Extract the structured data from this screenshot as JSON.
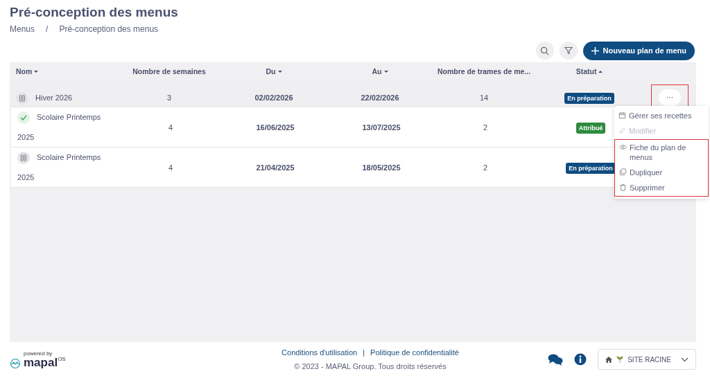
{
  "page": {
    "title": "Pré-conception des menus",
    "breadcrumb": [
      {
        "label": "Menus"
      },
      {
        "label": "Pré-conception des menus"
      }
    ],
    "breadcrumb_separator": "/"
  },
  "toolbar": {
    "new_button": "Nouveau plan de menu"
  },
  "table": {
    "columns": [
      {
        "label": "Nom",
        "kind": "desc"
      },
      {
        "label": "Nombre de semaines",
        "kind": "plain"
      },
      {
        "label": "Du",
        "kind": "desc"
      },
      {
        "label": "Au",
        "kind": "desc"
      },
      {
        "label": "Nombre de trames de me...",
        "kind": "plain"
      },
      {
        "label": "Statut",
        "kind": "asc"
      }
    ],
    "rows": [
      {
        "name": "Hiver 2026",
        "kind": "paused",
        "weeks": "3",
        "from": "02/02/2026",
        "to": "22/02/2026",
        "frames": "14",
        "status": "En préparation",
        "color": "#0f4c81",
        "selected": true,
        "actions": "···",
        "actions_highlighted": true
      },
      {
        "name": "Scolaire Printemps 2025",
        "kind": "assigned",
        "weeks": "4",
        "from": "16/06/2025",
        "to": "13/07/2025",
        "frames": "2",
        "status": "Attribué",
        "color": "#2e8b3e",
        "selected": false
      },
      {
        "name": "Scolaire Printemps 2025",
        "kind": "paused",
        "weeks": "4",
        "from": "21/04/2025",
        "to": "18/05/2025",
        "frames": "2",
        "status": "En préparation",
        "color": "#0f4c81",
        "selected": false
      }
    ]
  },
  "menu": {
    "items": [
      {
        "label": "Gérer ses recettes",
        "kind": "calendar",
        "disabled": false,
        "highlighted": false
      },
      {
        "label": "Modifier",
        "kind": "pencil",
        "disabled": true,
        "highlighted": false
      },
      {
        "label": "Fiche du plan de menus",
        "kind": "eye",
        "disabled": false,
        "highlighted": true
      },
      {
        "label": "Dupliquer",
        "kind": "copy",
        "disabled": false,
        "highlighted": true
      },
      {
        "label": "Supprimer",
        "kind": "trash",
        "disabled": false,
        "highlighted": true
      }
    ]
  },
  "footer": {
    "powered_by": "powered by",
    "brand": "mapal",
    "brand_suffix": "OS",
    "links": [
      "Conditions d'utilisation",
      "Politique de confidentialité"
    ],
    "separator": "|",
    "copyright": "© 2023 - MAPAL Group. Tous droits réservés",
    "site": "SITE RACINE"
  }
}
